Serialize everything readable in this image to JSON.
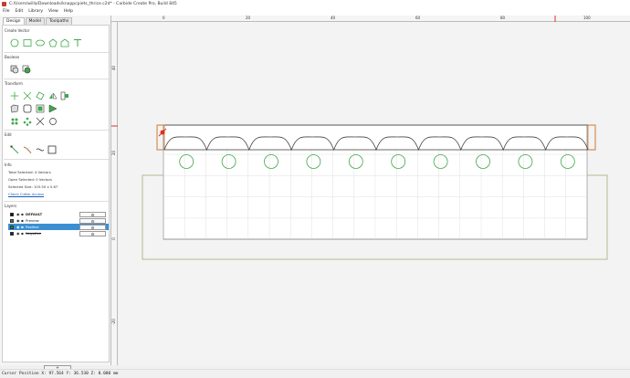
{
  "window": {
    "title": "C:/Users/willa/Downloads/knappcpiets_thrice.c2d* - Carbide Create Pro, Build 845"
  },
  "menu": [
    "File",
    "Edit",
    "Library",
    "View",
    "Help"
  ],
  "tabs": [
    {
      "label": "Design",
      "active": true
    },
    {
      "label": "Model",
      "active": false
    },
    {
      "label": "Toolpaths",
      "active": false
    }
  ],
  "sections": {
    "create_vector": "Create Vector",
    "boolean": "Boolean",
    "transform": "Transform",
    "edit": "Edit",
    "info": "Info",
    "layers": "Layers"
  },
  "info": {
    "total_selected": "Total Selected:   4 Vectors",
    "open_selected": "Open Selected:   0 Vectors",
    "selected_size": "Selected Size:   103.50 x 5.67",
    "check_link": "Check Cutter Access"
  },
  "layers": [
    {
      "name": "DEFAULT",
      "color": "#111111",
      "selected": false,
      "bold": true,
      "strike": false
    },
    {
      "name": "Preview",
      "color": "#6b6b1a",
      "selected": false,
      "bold": false,
      "strike": false
    },
    {
      "name": "Positive",
      "color": "#2a8a3a",
      "selected": true,
      "bold": false,
      "strike": false
    },
    {
      "name": "Negative",
      "color": "#1a1a7a",
      "selected": false,
      "bold": false,
      "strike": true
    }
  ],
  "layer_gear_glyph": "⚙",
  "add_layer_label": "+",
  "status": {
    "cursor": "Cursor Position X: 97.564 Y: 36.530 Z: 0.000 mm"
  },
  "ruler": {
    "top_labels": [
      "0",
      "20",
      "40",
      "60",
      "80",
      "100"
    ],
    "left_labels": [
      "40",
      "20",
      "0",
      "-20",
      "-40"
    ]
  },
  "colors": {
    "accent": "#3a8fd2",
    "vector_green": "#3ea84a",
    "stock_olive": "#a8a878"
  }
}
